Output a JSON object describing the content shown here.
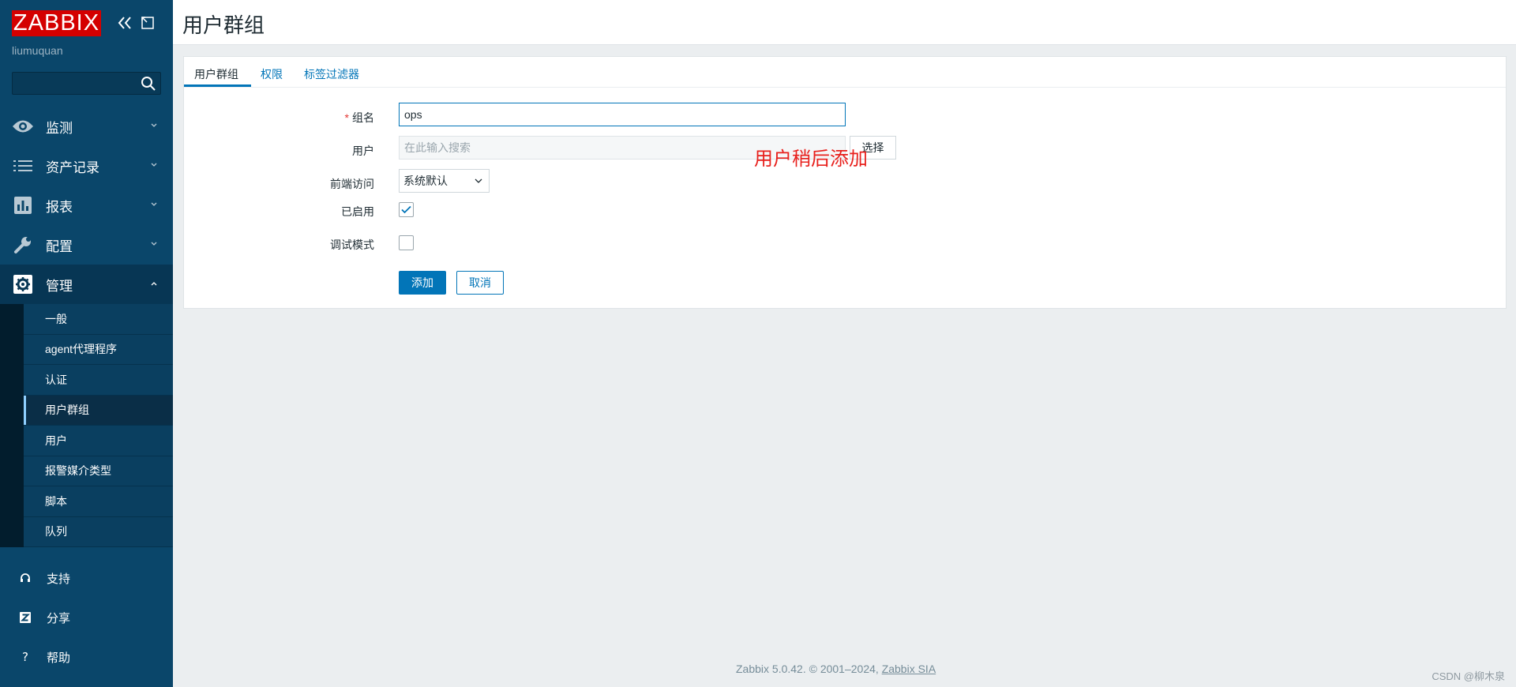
{
  "sidebar": {
    "logo": "ZABBIX",
    "username": "liumuquan",
    "search": {
      "value": "",
      "placeholder": ""
    },
    "menu": [
      {
        "label": "监测",
        "icon": "eye-icon"
      },
      {
        "label": "资产记录",
        "icon": "list-icon"
      },
      {
        "label": "报表",
        "icon": "bar-chart-icon"
      },
      {
        "label": "配置",
        "icon": "wrench-icon"
      },
      {
        "label": "管理",
        "icon": "gear-icon"
      }
    ],
    "submenu": [
      "一般",
      "agent代理程序",
      "认证",
      "用户群组",
      "用户",
      "报警媒介类型",
      "脚本",
      "队列"
    ],
    "bottom": [
      {
        "label": "支持",
        "icon": "headset-icon"
      },
      {
        "label": "分享",
        "icon": "share-z-icon"
      },
      {
        "label": "帮助",
        "icon": "help-icon"
      }
    ]
  },
  "header": {
    "title": "用户群组"
  },
  "tabs": [
    "用户群组",
    "权限",
    "标签过滤器"
  ],
  "form": {
    "group_name_label": "组名",
    "group_name_value": "ops",
    "users_label": "用户",
    "users_placeholder": "在此输入搜索",
    "select_button": "选择",
    "frontend_access_label": "前端访问",
    "frontend_access_value": "系统默认",
    "enabled_label": "已启用",
    "enabled": true,
    "debug_label": "调试模式",
    "debug": false,
    "add_button": "添加",
    "cancel_button": "取消"
  },
  "annotation": "用户稍后添加",
  "footer": {
    "text": "Zabbix 5.0.42. © 2001–2024, ",
    "link": "Zabbix SIA"
  },
  "watermark": "CSDN @柳木泉",
  "colors": {
    "sidebar": "#0a466a",
    "accent": "#0275b8",
    "logo": "#d40000",
    "annotation": "#e8201c"
  }
}
